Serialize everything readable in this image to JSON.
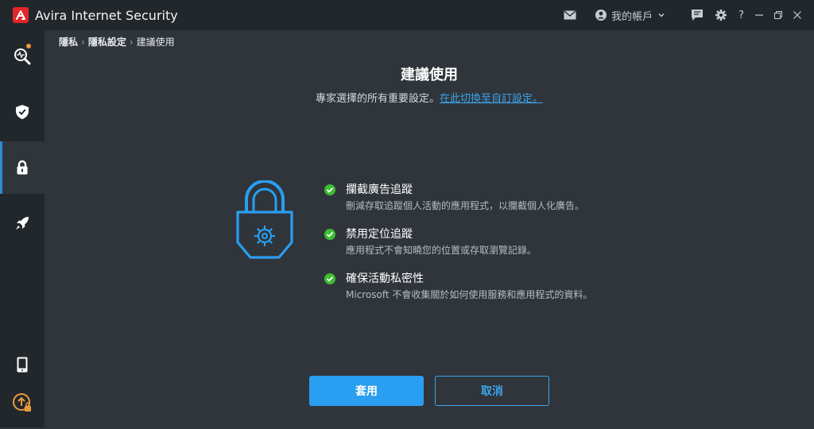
{
  "app": {
    "title": "Avira Internet Security"
  },
  "titlebar": {
    "account_label": "我的帳戶",
    "help_label": "?"
  },
  "breadcrumb": {
    "items": [
      "隱私",
      "隱私設定",
      "建議使用"
    ]
  },
  "main": {
    "title": "建議使用",
    "subtitle_text": "專家選擇的所有重要設定。",
    "subtitle_link": "在此切換至自訂設定。",
    "features": [
      {
        "title": "攔截廣告追蹤",
        "description": "刪減存取追蹤個人活動的應用程式，以攔截個人化廣告。"
      },
      {
        "title": "禁用定位追蹤",
        "description": "應用程式不會知曉您的位置或存取瀏覽記錄。"
      },
      {
        "title": "確保活動私密性",
        "description": "Microsoft 不會收集關於如何使用服務和應用程式的資料。"
      }
    ],
    "apply_label": "套用",
    "cancel_label": "取消"
  },
  "sidebar": {
    "items": [
      "scan-icon",
      "shield-icon",
      "lock-icon",
      "rocket-icon",
      "mobile-icon",
      "upgrade-icon"
    ]
  },
  "colors": {
    "accent": "#2a9ef0",
    "brand": "#e5252a",
    "check": "#3dbd32",
    "notification": "#e99a3a",
    "upgrade": "#e99a3a"
  }
}
